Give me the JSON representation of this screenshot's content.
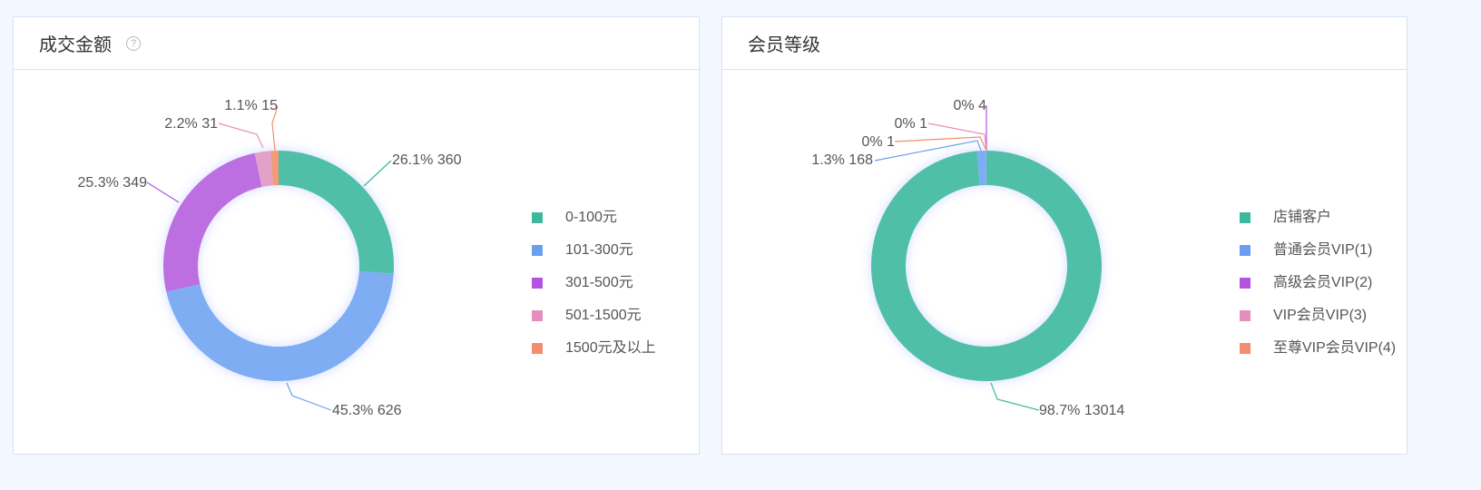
{
  "cards": [
    {
      "title": "成交金额",
      "help_icon": "?",
      "chart_data": {
        "type": "pie",
        "donut": true,
        "legend_position": "right",
        "categories": [
          "0-100元",
          "101-300元",
          "301-500元",
          "501-1500元",
          "1500元及以上"
        ],
        "values": [
          360,
          626,
          349,
          31,
          15
        ],
        "percent_labels": [
          "26.1%",
          "45.3%",
          "25.3%",
          "2.2%",
          "1.1%"
        ],
        "colors": [
          "#4fbfa7",
          "#7fadf4",
          "#bd6ee0",
          "#e3a1c8",
          "#f39a76"
        ],
        "legend_colors": [
          "#3db89c",
          "#6a9ff0",
          "#b353e0",
          "#e38fbd",
          "#f28e6e"
        ]
      }
    },
    {
      "title": "会员等级",
      "chart_data": {
        "type": "pie",
        "donut": true,
        "legend_position": "right",
        "categories": [
          "店铺客户",
          "普通会员VIP(1)",
          "高级会员VIP(2)",
          "VIP会员VIP(3)",
          "至尊VIP会员VIP(4)"
        ],
        "values": [
          13014,
          168,
          4,
          1,
          1
        ],
        "percent_labels": [
          "98.7%",
          "1.3%",
          "0%",
          "0%",
          "0%"
        ],
        "colors": [
          "#4fbfa7",
          "#7fadf4",
          "#bd6ee0",
          "#e3a1c8",
          "#f39a76"
        ],
        "legend_colors": [
          "#3db89c",
          "#6a9ff0",
          "#b353e0",
          "#e38fbd",
          "#f28e6e"
        ]
      }
    }
  ]
}
